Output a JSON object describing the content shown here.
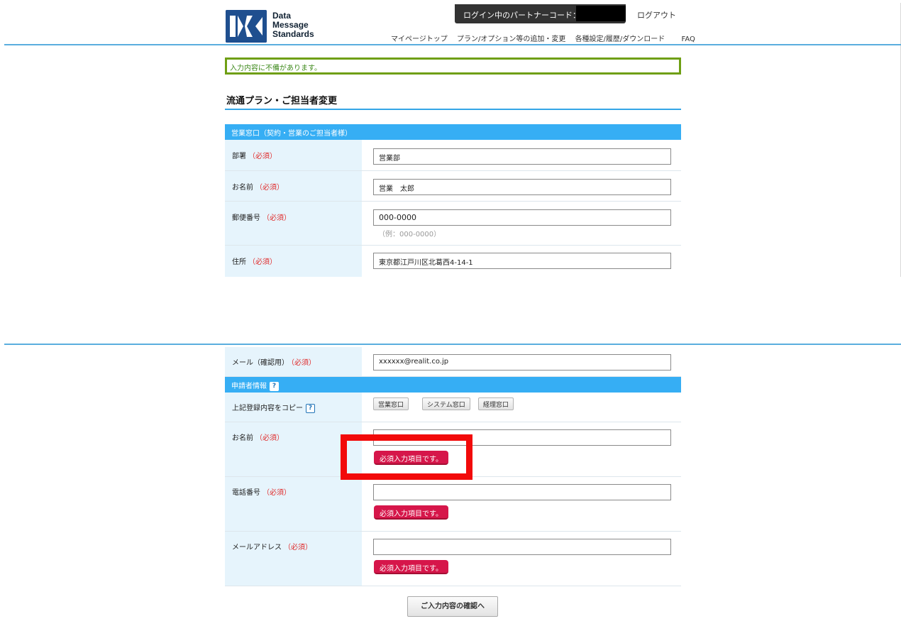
{
  "header": {
    "logo_text": "Data Message Standards",
    "partner_code_label": "ログイン中のパートナーコード：",
    "logout": "ログアウト",
    "nav": [
      "マイページトップ",
      "プラン/オプション等の追加・変更",
      "各種設定/履歴/ダウンロード",
      "FAQ"
    ]
  },
  "error_message": "入力内容に不備があります。",
  "page_title": "流通プラン・ご担当者変更",
  "required_mark": "（必須）",
  "sales_section": {
    "heading": "営業窓口（契約・営業のご担当者様）",
    "fields": [
      {
        "label": "部署",
        "value": "営業部"
      },
      {
        "label": "お名前",
        "value": "営業　太郎"
      },
      {
        "label": "郵便番号",
        "value": "000-0000",
        "hint": "（例：000-0000）"
      },
      {
        "label": "住所",
        "value": "東京都江戸川区北葛西4-14-1"
      }
    ]
  },
  "confirm_email": {
    "label": "メール（確認用）",
    "value": "xxxxxx@realit.co.jp"
  },
  "applicant_section": {
    "heading": "申請者情報",
    "help_icon": "?",
    "copy_label": "上記登録内容をコピー",
    "copy_buttons": [
      "営業窓口",
      "システム窓口",
      "経理窓口"
    ],
    "fields": [
      {
        "label": "お名前",
        "value": "",
        "error": "必須入力項目です。"
      },
      {
        "label": "電話番号",
        "value": "",
        "error": "必須入力項目です。"
      },
      {
        "label": "メールアドレス",
        "value": "",
        "error": "必須入力項目です。"
      }
    ]
  },
  "confirm_button": "ご入力内容の確認へ",
  "colors": {
    "section_header": "#36aef4",
    "label_bg": "#e6f4fc",
    "required": "#e02a2a",
    "error_pill": "#d6164a",
    "error_border": "#6f9f14",
    "annotation": "#f20a0a"
  }
}
